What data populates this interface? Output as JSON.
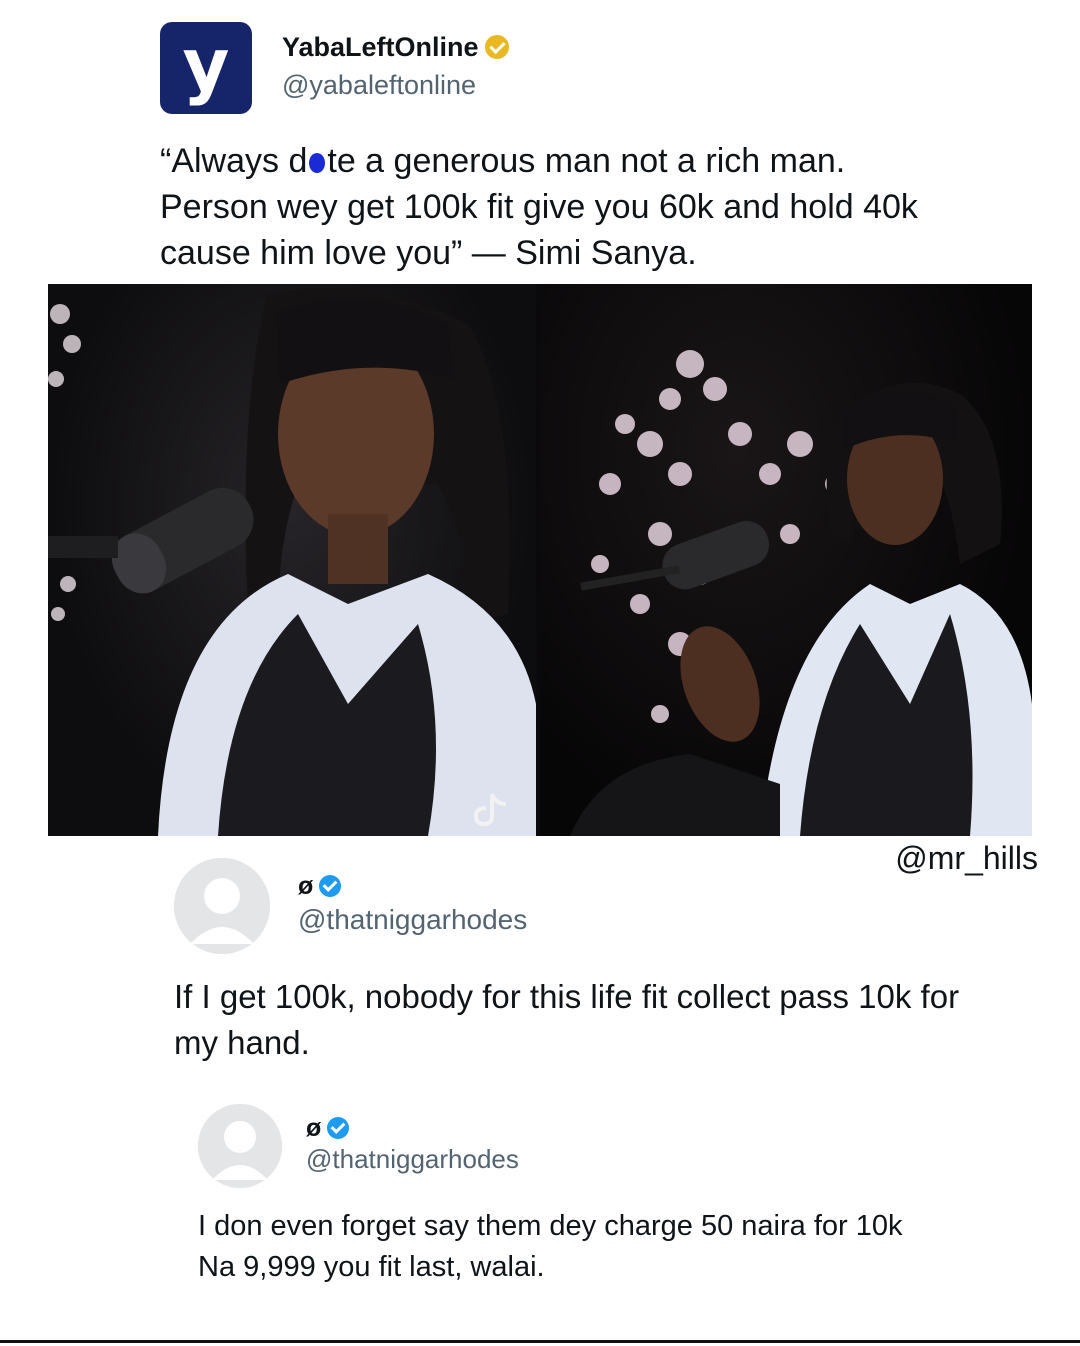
{
  "post": {
    "logo_letter": "y",
    "author_name": "YabaLeftOnline",
    "author_handle": "@yabaleftonline",
    "verified_badge": "gold-verified-icon",
    "quote_part1": "“Always d",
    "quote_part2": "te a generous man not a rich man. Person wey get 100k fit give you 60k and hold 40k cause him love you” — Simi Sanya.",
    "brand_color": "#16256a",
    "watermark": "TikTok"
  },
  "credit": "@mr_hills",
  "reply1": {
    "name": "ø",
    "handle": "@thatniggarhodes",
    "verified_badge": "blue-verified-icon",
    "text": "If I get 100k, nobody for this life fit collect pass 10k for my hand."
  },
  "reply2": {
    "name": "ø",
    "handle": "@thatniggarhodes",
    "verified_badge": "blue-verified-icon",
    "line1": "I don even forget say them dey charge 50 naira for 10k",
    "line2": "Na 9,999 you fit last, walai."
  },
  "colors": {
    "gold_badge": "#e8b923",
    "blue_badge": "#1d9bf0",
    "handle_gray": "#536471"
  }
}
